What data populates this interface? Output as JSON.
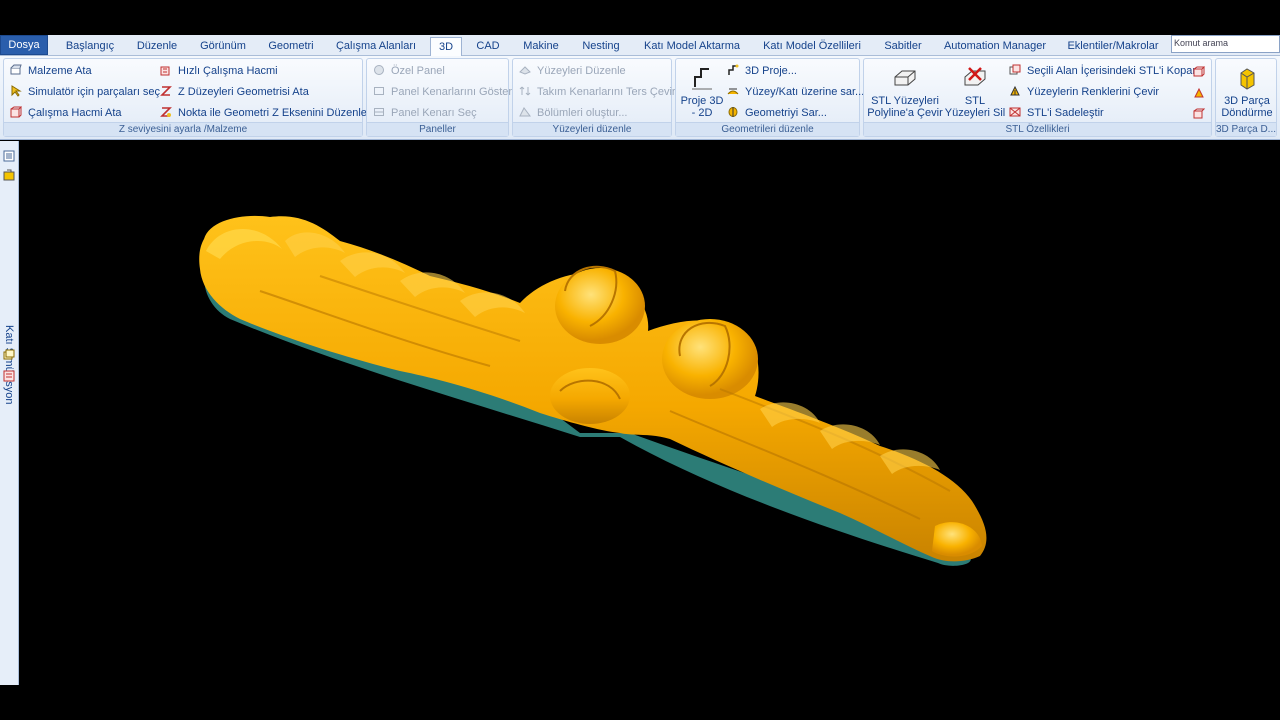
{
  "tabs": [
    "Dosya",
    "Başlangıç",
    "Düzenle",
    "Görünüm",
    "Geometri",
    "Çalışma Alanları",
    "3D",
    "CAD",
    "Makine",
    "Nesting",
    "Katı Model Aktarma",
    "Katı Model Özellileri",
    "Sabitler",
    "Automation Manager",
    "Eklentiler/Makrolar"
  ],
  "search": {
    "placeholder": "Komut arama"
  },
  "groups": {
    "z_level": {
      "label": "Z seviyesini ayarla /Malzeme",
      "items": [
        "Malzeme Ata",
        "Simulatör için parçaları seç",
        "Çalışma Hacmi Ata",
        "Hızlı Çalışma Hacmi",
        "Z Düzeyleri Geometrisi Ata",
        "Nokta ile Geometri Z Eksenini Düzenle"
      ]
    },
    "panels": {
      "label": "Paneller",
      "items": [
        "Özel Panel",
        "Panel Kenarlarını Göster",
        "Panel Kenarı Seç"
      ]
    },
    "surfaces": {
      "label": "Yüzeyleri düzenle",
      "items": [
        "Yüzeyleri Düzenle",
        "Takım Kenarlarını Ters Çevir",
        "Bölümleri oluştur..."
      ]
    },
    "geometry": {
      "label": "Geometrileri düzenle",
      "big": "Proje 3D - 2D",
      "items": [
        "3D Proje...",
        "Yüzey/Katı üzerine sar...",
        "Geometriyi Sar..."
      ]
    },
    "stl": {
      "label": "STL Özellikleri",
      "big1": "STL Yüzeyleri Polyline'a Çevir",
      "big2": "STL Yüzeyleri Sil",
      "items": [
        "Seçili Alan İçerisindeki STL'i Kopar",
        "Yüzeylerin Renklerini Çevir",
        "STL'i Sadeleştir"
      ]
    },
    "part3d": {
      "label": "3D Parça D...",
      "big": "3D Parça Döndürme"
    }
  },
  "sidebar": {
    "label": "Katı Simülasyon"
  },
  "colors": {
    "model": "#f5a800",
    "viewport": "#000000",
    "ribbon": "#dfe9f6"
  }
}
